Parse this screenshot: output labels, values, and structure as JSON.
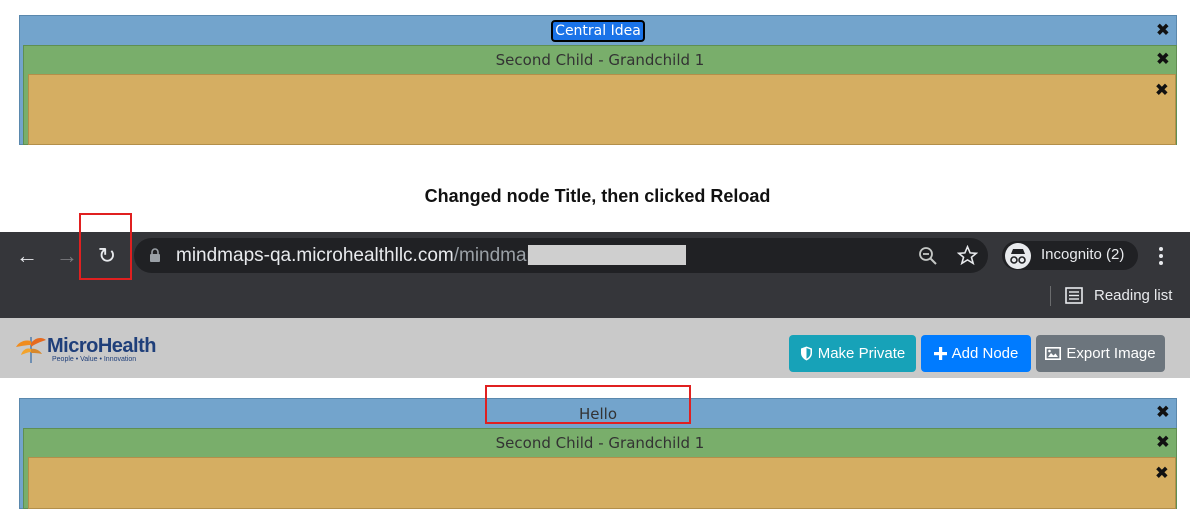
{
  "before": {
    "central_title": "Central Idea",
    "child_title": "Second Child - Grandchild 1"
  },
  "caption": "Changed node Title, then clicked Reload",
  "browser": {
    "url_host": "mindmaps-qa.microhealthllc.com",
    "url_path": "/mindmaps/",
    "incognito_label": "Incognito (2)",
    "reading_list_label": "Reading list"
  },
  "app": {
    "logo_name": "MicroHealth",
    "logo_tagline": "People • Value • Innovation",
    "buttons": {
      "make_private": "Make Private",
      "add_node": "Add Node",
      "export_image": "Export Image"
    }
  },
  "after": {
    "central_title": "Hello",
    "child_title": "Second Child - Grandchild 1"
  },
  "icons": {
    "close": "✖",
    "back": "←",
    "forward": "→",
    "reload": "↻"
  },
  "colors": {
    "central": "#73a4cc",
    "child": "#79ae6b",
    "grandchild": "#d5ae62",
    "highlight": "#e02020"
  }
}
